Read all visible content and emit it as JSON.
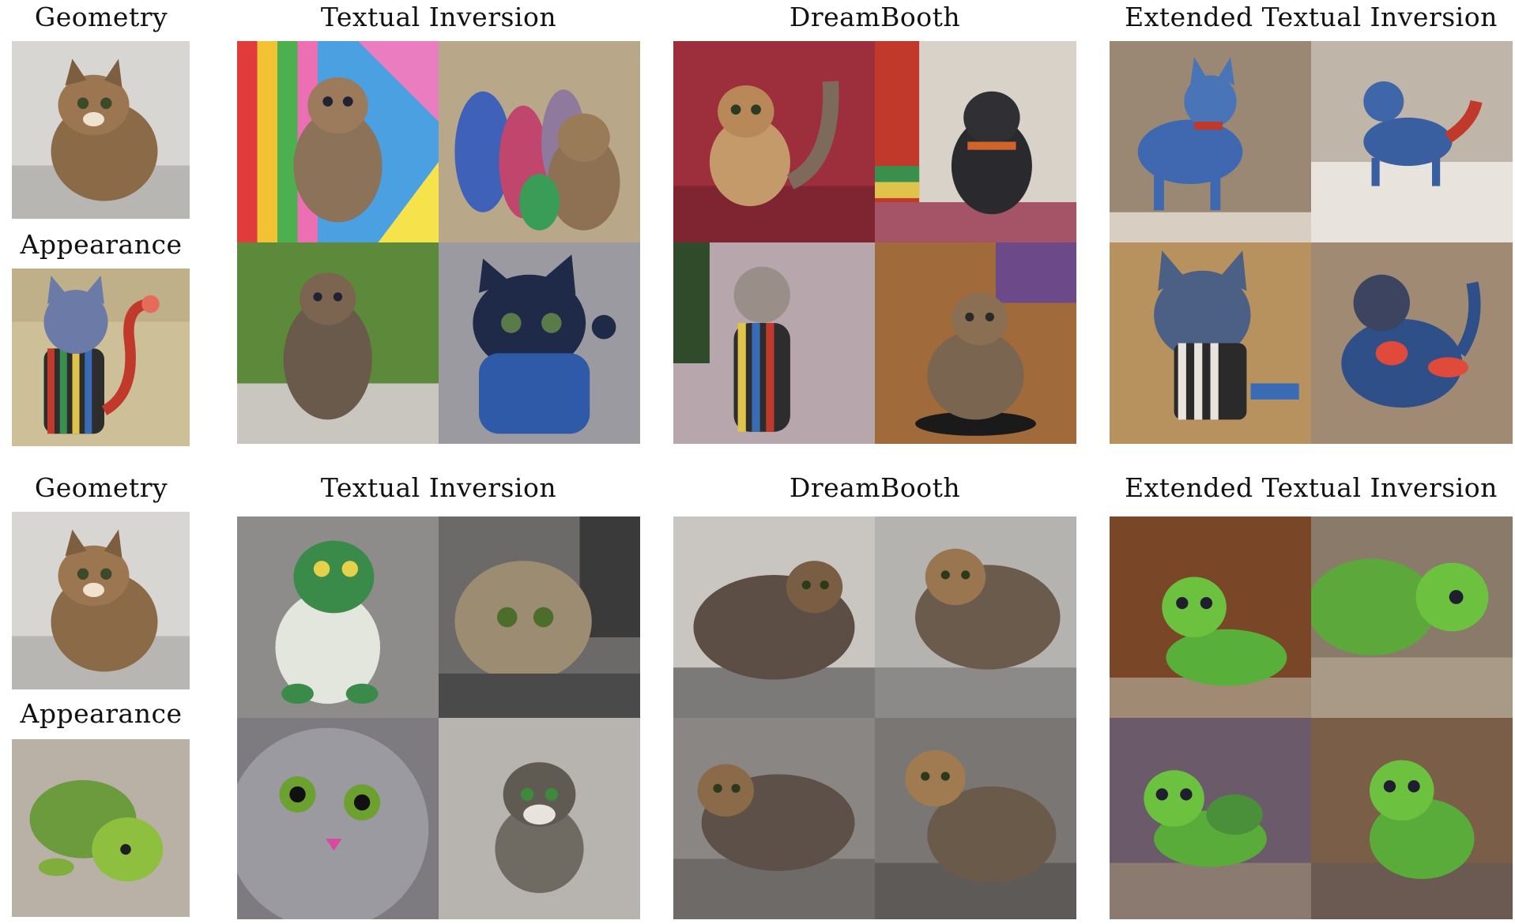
{
  "figure": {
    "rows": [
      {
        "geometry_label": "Geometry",
        "appearance_label": "Appearance",
        "method_labels": [
          "Textual Inversion",
          "DreamBooth",
          "Extended Textual Inversion"
        ]
      },
      {
        "geometry_label": "Geometry",
        "appearance_label": "Appearance",
        "method_labels": [
          "Textual Inversion",
          "DreamBooth",
          "Extended Textual Inversion"
        ]
      }
    ]
  }
}
